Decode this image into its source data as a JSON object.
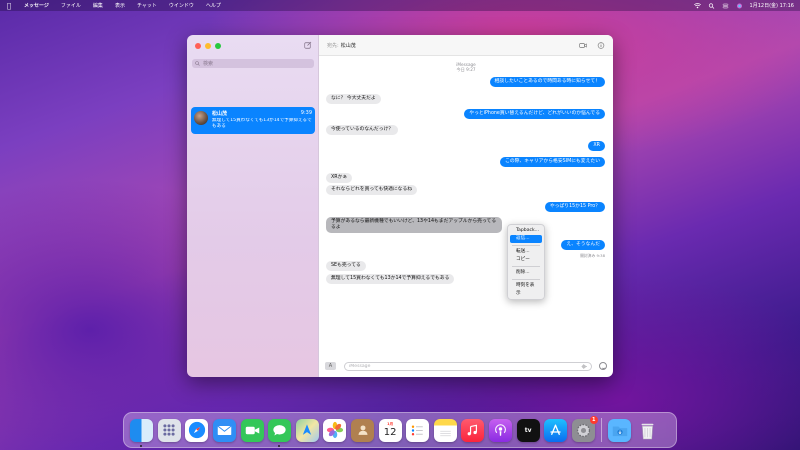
{
  "menubar": {
    "app_name": "メッセージ",
    "items": [
      "ファイル",
      "編集",
      "表示",
      "チャット",
      "ウインドウ",
      "ヘルプ"
    ],
    "datetime": "1月12日(金) 17:16"
  },
  "sidebar": {
    "search_placeholder": "検索",
    "conversation": {
      "name": "松山茂",
      "time": "9:39",
      "preview": "無理して15買わなくても13か14で予算抑えるでもある"
    }
  },
  "chat": {
    "to_label": "宛先:",
    "recipient": "松山茂",
    "service": "iMessage",
    "date": "今日 9:27",
    "messages": [
      {
        "from": "me",
        "text": "相談したいことあるので時間ある時に知らせて！"
      },
      {
        "from": "them",
        "text": "なに？ 今大丈夫だよ"
      },
      {
        "from": "me",
        "text": "やっとiPhone買い替えるんだけど、どれがいいのか悩んでる"
      },
      {
        "from": "them",
        "text": "今使っているのなんだっけ？"
      },
      {
        "from": "me",
        "text": "XR"
      },
      {
        "from": "me",
        "text": "この際、キャリアから格安SIMにも変えたい"
      },
      {
        "from": "them",
        "text": "XRかぁ"
      },
      {
        "from": "them",
        "text": "それならどれを買っても快適になるね"
      },
      {
        "from": "me",
        "text": "やっぱり15か15 Pro？"
      },
      {
        "from": "them",
        "text_line1": "予算があるなら最新機種でもいいけど、13や14もまだアップルから売ってる",
        "text_line2": "るよ"
      },
      {
        "from": "me",
        "text": "え、そうなんだ"
      },
      {
        "from": "them",
        "text": "SEも売ってる"
      },
      {
        "from": "them",
        "text": "無理して15買わなくても13か14で予算抑えるでもある"
      }
    ],
    "read_status": "開封済み 9:38",
    "input_placeholder": "iMessage"
  },
  "context_menu": {
    "items": [
      "Tapback...",
      "返信...",
      "転送...",
      "コピー",
      "削除...",
      "時刻を表示"
    ],
    "highlighted": "返信..."
  },
  "dock": {
    "calendar_month": "1月",
    "calendar_day": "12",
    "appletv_label": "tv",
    "settings_badge": "1"
  },
  "colors": {
    "accent": "#0a84ff",
    "incoming_bubble": "#e9e9eb"
  }
}
